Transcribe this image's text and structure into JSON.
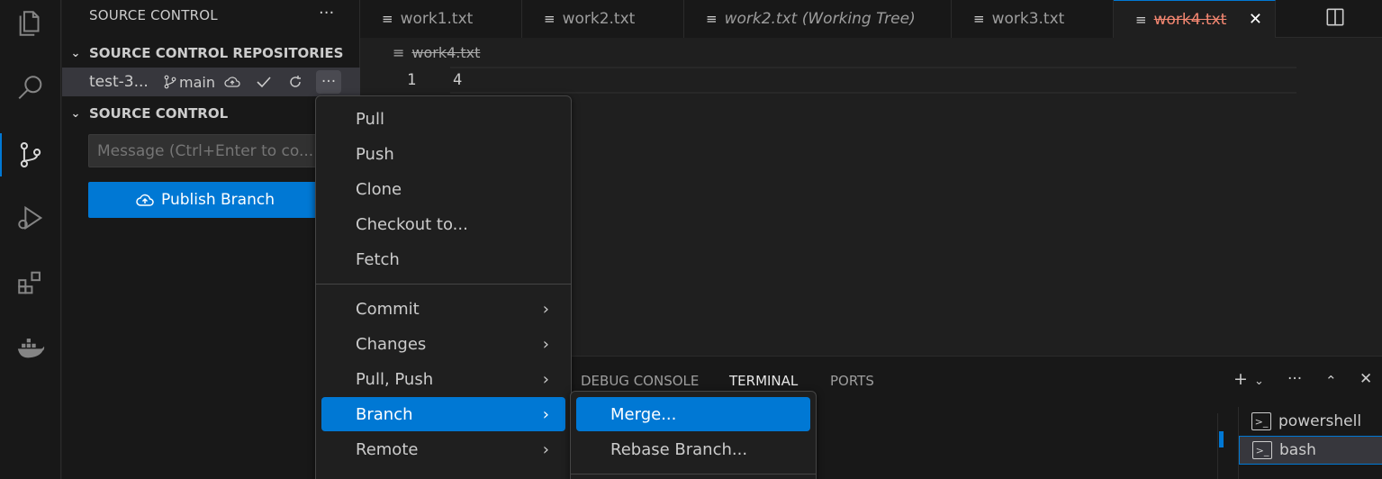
{
  "sidebar": {
    "title": "SOURCE CONTROL",
    "more": "···",
    "repos_header": "SOURCE CONTROL REPOSITORIES",
    "repo": {
      "name": "test-3...",
      "branch": "main",
      "more": "···"
    },
    "sc_header": "SOURCE CONTROL",
    "message_placeholder": "Message (Ctrl+Enter to co...",
    "publish_label": "Publish Branch"
  },
  "tabs": [
    {
      "label": "work1.txt"
    },
    {
      "label": "work2.txt"
    },
    {
      "label": "work2.txt (Working Tree)"
    },
    {
      "label": "work3.txt"
    },
    {
      "label": "work4.txt"
    }
  ],
  "editor": {
    "breadcrumb": "work4.txt",
    "line_number": "1",
    "line_text": "4"
  },
  "panel": {
    "tabs": [
      "DEBUG CONSOLE",
      "TERMINAL",
      "PORTS"
    ],
    "active_tab": "TERMINAL",
    "terminals": [
      "powershell",
      "bash"
    ]
  },
  "menu": {
    "items": [
      "Pull",
      "Push",
      "Clone",
      "Checkout to...",
      "Fetch",
      "Commit",
      "Changes",
      "Pull, Push",
      "Branch",
      "Remote"
    ],
    "highlighted": "Branch"
  },
  "submenu": {
    "items": [
      "Merge...",
      "Rebase Branch..."
    ],
    "highlighted": "Merge..."
  },
  "colors": {
    "accent": "#0078d4",
    "modified_tab": "#f48771"
  }
}
